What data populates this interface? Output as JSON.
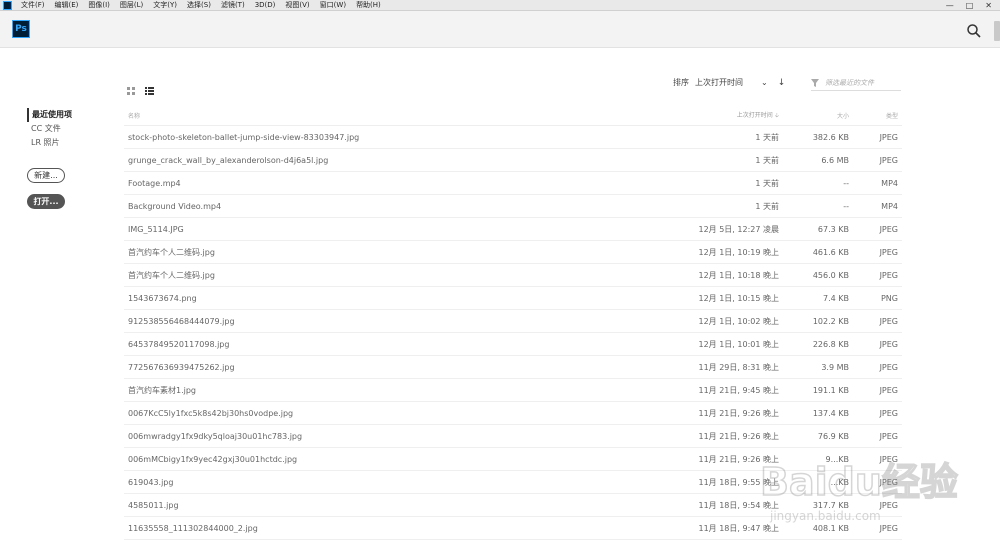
{
  "menubar": {
    "items": [
      "文件(F)",
      "编辑(E)",
      "图像(I)",
      "图层(L)",
      "文字(Y)",
      "选择(S)",
      "滤镜(T)",
      "3D(D)",
      "视图(V)",
      "窗口(W)",
      "帮助(H)"
    ],
    "win_controls": [
      "—",
      "□",
      "✕"
    ]
  },
  "header": {
    "logo_text": "Ps"
  },
  "sidebar": {
    "items": [
      {
        "label": "最近使用项"
      },
      {
        "label": "CC 文件"
      },
      {
        "label": "LR 照片"
      }
    ],
    "new_button": "新建...",
    "open_button": "打开..."
  },
  "controls": {
    "sort_label": "排序",
    "sort_value": "上次打开时间",
    "sort_chevron": "⌄",
    "sort_direction": "↓",
    "filter_placeholder": "筛选最近的文件"
  },
  "table": {
    "columns": {
      "name": "名称",
      "date": "上次打开时间 🡣",
      "size": "大小",
      "type": "类型"
    },
    "rows": [
      {
        "name": "stock-photo-skeleton-ballet-jump-side-view-83303947.jpg",
        "date": "1 天前",
        "size": "382.6 KB",
        "type": "JPEG"
      },
      {
        "name": "grunge_crack_wall_by_alexanderolson-d4j6a5l.jpg",
        "date": "1 天前",
        "size": "6.6 MB",
        "type": "JPEG"
      },
      {
        "name": "Footage.mp4",
        "date": "1 天前",
        "size": "--",
        "type": "MP4"
      },
      {
        "name": "Background Video.mp4",
        "date": "1 天前",
        "size": "--",
        "type": "MP4"
      },
      {
        "name": "IMG_5114.JPG",
        "date": "12月 5日, 12:27 凌晨",
        "size": "67.3 KB",
        "type": "JPEG"
      },
      {
        "name": "首汽约车个人二维码.jpg",
        "date": "12月 1日, 10:19 晚上",
        "size": "461.6 KB",
        "type": "JPEG"
      },
      {
        "name": "首汽约车个人二维码.jpg",
        "date": "12月 1日, 10:18 晚上",
        "size": "456.0 KB",
        "type": "JPEG"
      },
      {
        "name": "1543673674.png",
        "date": "12月 1日, 10:15 晚上",
        "size": "7.4 KB",
        "type": "PNG"
      },
      {
        "name": "912538556468444079.jpg",
        "date": "12月 1日, 10:02 晚上",
        "size": "102.2 KB",
        "type": "JPEG"
      },
      {
        "name": "645378495201170​98.jpg",
        "date": "12月 1日, 10:01 晚上",
        "size": "226.8 KB",
        "type": "JPEG"
      },
      {
        "name": "772567636939475262.jpg",
        "date": "11月 29日, 8:31 晚上",
        "size": "3.9 MB",
        "type": "JPEG"
      },
      {
        "name": "首汽约车素材1.jpg",
        "date": "11月 21日, 9:45 晚上",
        "size": "191.1 KB",
        "type": "JPEG"
      },
      {
        "name": "0067KcC5ly1fxc5k8s42bj30hs0vodpe.jpg",
        "date": "11月 21日, 9:26 晚上",
        "size": "137.4 KB",
        "type": "JPEG"
      },
      {
        "name": "006mwradgy1fx9dky5qloaj30u01hc783.jpg",
        "date": "11月 21日, 9:26 晚上",
        "size": "76.9 KB",
        "type": "JPEG"
      },
      {
        "name": "006mMCbigy1fx9yec42gxj30u01hctdc.jpg",
        "date": "11月 21日, 9:26 晚上",
        "size": "9...KB",
        "type": "JPEG"
      },
      {
        "name": "619043.jpg",
        "date": "11月 18日, 9:55 晚上",
        "size": "...KB",
        "type": "JPEG"
      },
      {
        "name": "4585011.jpg",
        "date": "11月 18日, 9:54 晚上",
        "size": "317.7 KB",
        "type": "JPEG"
      },
      {
        "name": "11635558_111302844000_2.jpg",
        "date": "11月 18日, 9:47 晚上",
        "size": "408.1 KB",
        "type": "JPEG"
      }
    ]
  },
  "watermark": {
    "text": "Baidu经验",
    "subtext": "jingyan.baidu.com"
  }
}
